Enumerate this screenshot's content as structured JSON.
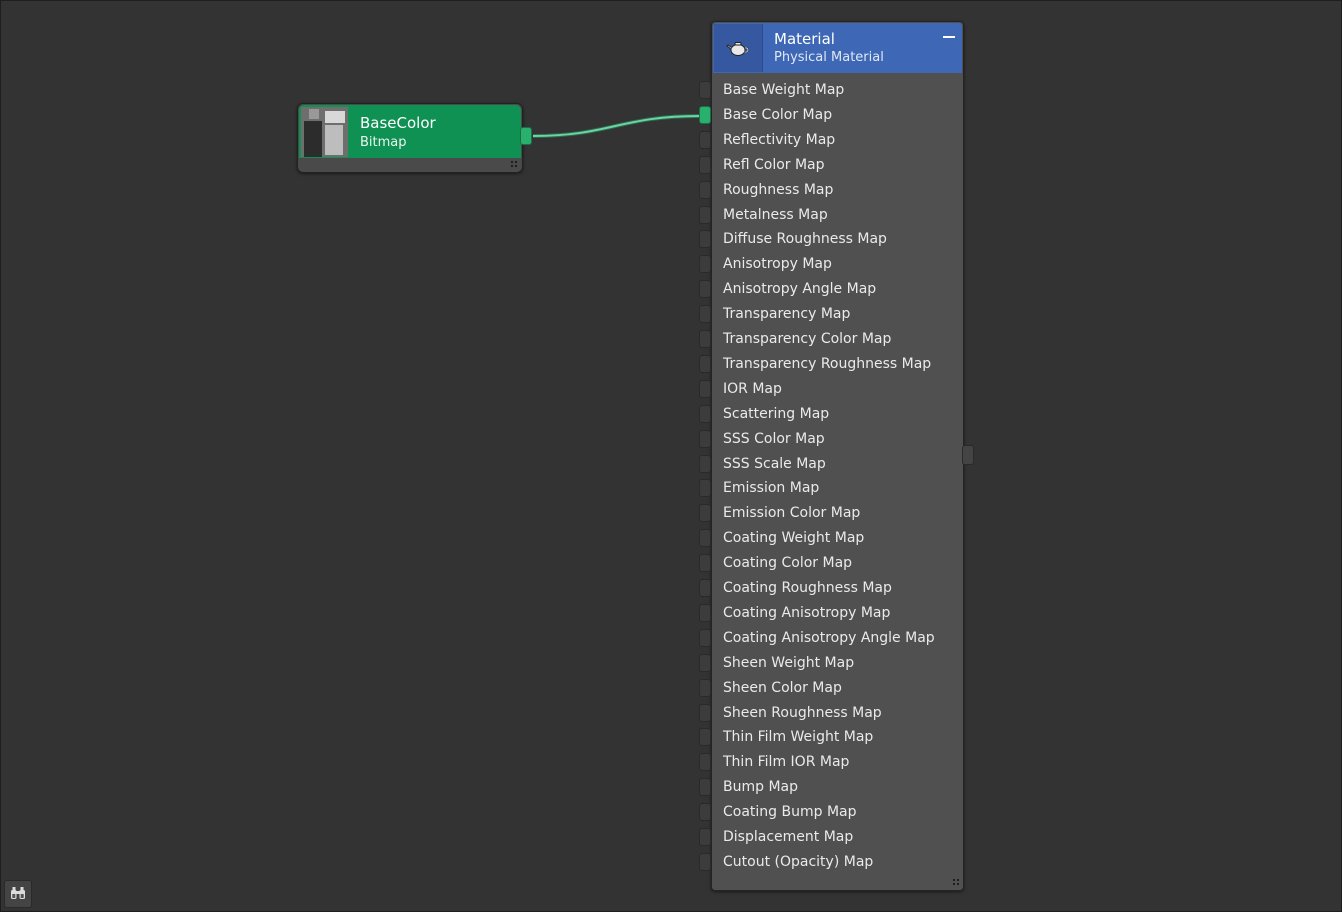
{
  "bitmap_node": {
    "title": "BaseColor",
    "subtitle": "Bitmap",
    "color": "#0f9154"
  },
  "material_node": {
    "title": "Material",
    "subtitle": "Physical Material",
    "icon": "teapot-icon",
    "color": "#3e68b5",
    "ports": [
      "Base Weight Map",
      "Base Color Map",
      "Reflectivity Map",
      "Refl Color Map",
      "Roughness Map",
      "Metalness Map",
      "Diffuse Roughness Map",
      "Anisotropy Map",
      "Anisotropy Angle Map",
      "Transparency Map",
      "Transparency Color Map",
      "Transparency Roughness Map",
      "IOR Map",
      "Scattering Map",
      "SSS Color Map",
      "SSS Scale Map",
      "Emission Map",
      "Emission Color Map",
      "Coating Weight Map",
      "Coating Color Map",
      "Coating Roughness Map",
      "Coating Anisotropy Map",
      "Coating Anisotropy Angle Map",
      "Sheen Weight Map",
      "Sheen Color Map",
      "Sheen Roughness Map",
      "Thin Film Weight Map",
      "Thin Film IOR Map",
      "Bump Map",
      "Coating Bump Map",
      "Displacement Map",
      "Cutout (Opacity) Map"
    ],
    "connected_port": "Base Color Map"
  },
  "wire_color": "#6fd3a3",
  "toolbar": {
    "find_icon": "binoculars-icon"
  }
}
